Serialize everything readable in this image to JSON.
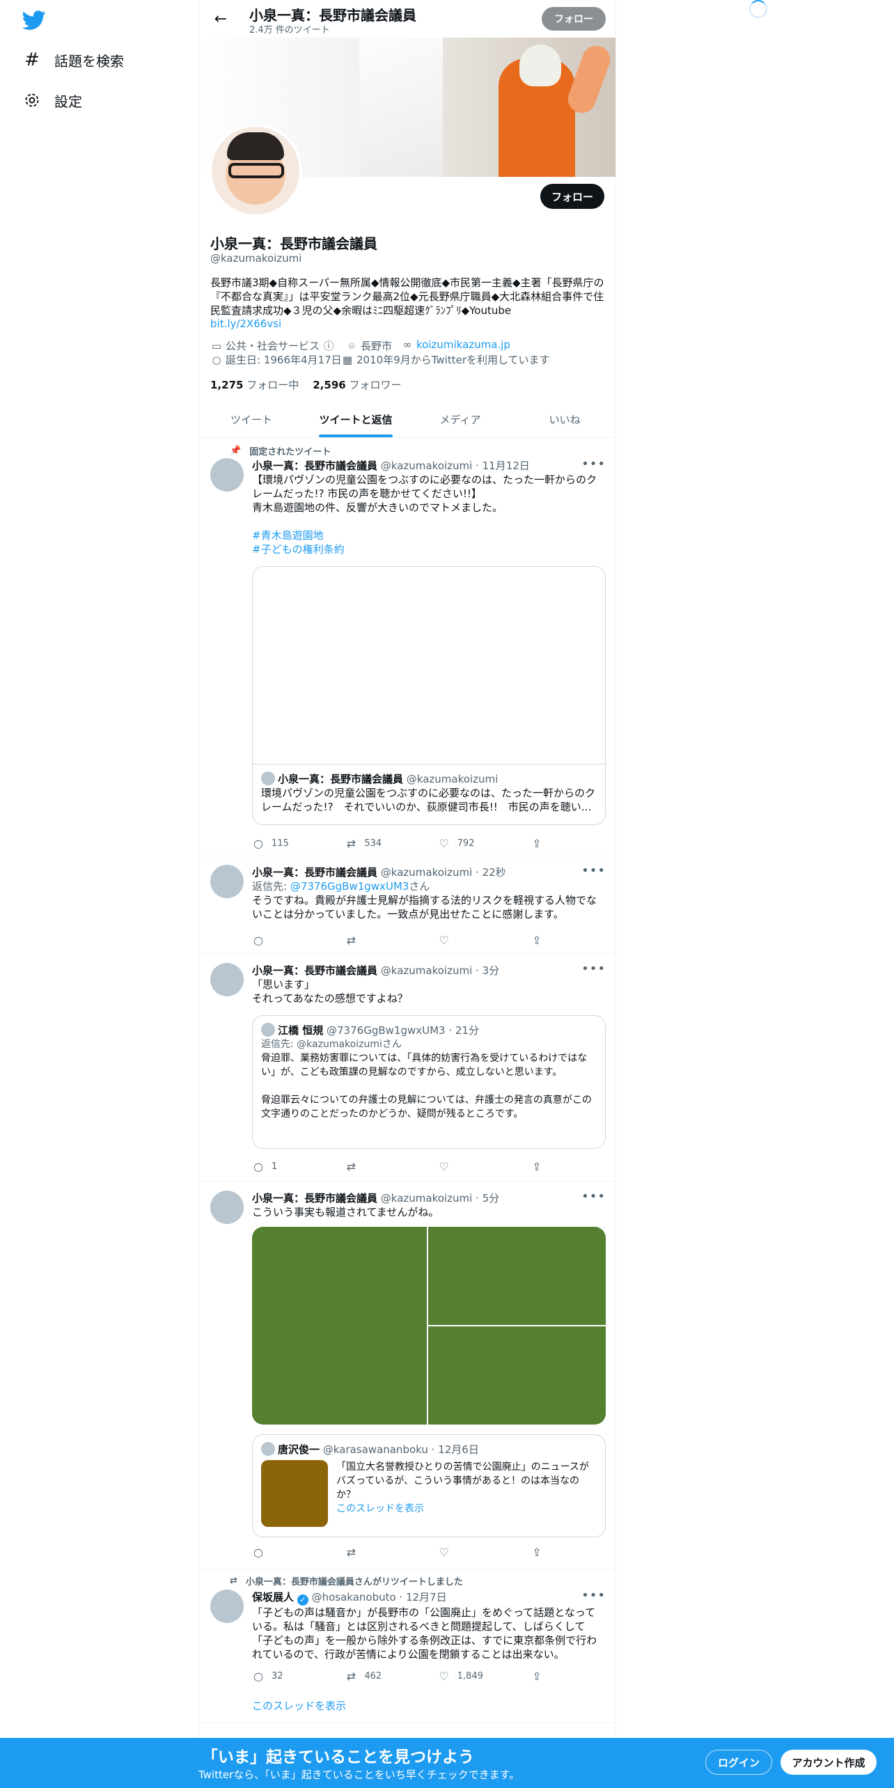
{
  "sidebar": {
    "items": [
      {
        "label": "話題を検索",
        "icon": "hashtag-icon"
      },
      {
        "label": "設定",
        "icon": "gear-icon"
      }
    ]
  },
  "header": {
    "title": "小泉一真：長野市議会議員",
    "tweet_count": "2.4万 件のツイート",
    "follow_label": "フォロー"
  },
  "profile": {
    "name": "小泉一真：長野市議会議員",
    "handle": "@kazumakoizumi",
    "bio": "長野市議3期◆自称スーパー無所属◆情報公開徹底◆市民第一主義◆主著「長野県庁の『不都合な真実』」は平安堂ランク最高2位◆元長野県庁職員◆大北森林組合事件で住民監査請求成功◆３児の父◆余暇はﾐﾆ四駆超速ｸﾞﾗﾝﾌﾟﾘ◆Youtube",
    "bio_link": "bit.ly/2X66vsi",
    "follow_label": "フォロー",
    "category": "公共・社会サービス",
    "location": "長野市",
    "website": "koizumikazuma.jp",
    "birthday": "誕生日: 1966年4月17日",
    "joined": "2010年9月からTwitterを利用しています",
    "following_count": "1,275",
    "following_label": "フォロー中",
    "followers_count": "2,596",
    "followers_label": "フォロワー"
  },
  "tabs": [
    {
      "label": "ツイート",
      "active": false
    },
    {
      "label": "ツイートと返信",
      "active": true
    },
    {
      "label": "メディア",
      "active": false
    },
    {
      "label": "いいね",
      "active": false
    }
  ],
  "tweets": [
    {
      "pinned_label": "固定されたツイート",
      "name": "小泉一真：長野市議会議員",
      "handle": "@kazumakoizumi",
      "time": "11月12日",
      "text": "【環境パヴゾンの児童公園をつぶすのに必要なのは、たった一軒からのクレームだった!? 市民の声を聴かせてください!!】\n青木島遊園地の件、反響が大きいのでマトメました。",
      "hashtags": [
        "#青木島遊園地",
        "#子どもの権利条約"
      ],
      "card_name": "小泉一真：長野市議会議員",
      "card_handle": "@kazumakoizumi",
      "card_text": "環境パヴゾンの児童公園をつぶすのに必要なのは、たった一軒からのクレームだった!?　それでいいのか、荻原健司市長!!　市民の声を聴い…",
      "replies": "115",
      "retweets": "534",
      "likes": "792"
    },
    {
      "name": "小泉一真：長野市議会議員",
      "handle": "@kazumakoizumi",
      "time": "22秒",
      "reply_to_prefix": "返信先: ",
      "reply_to": "@7376GgBw1gwxUM3",
      "reply_to_suffix": "さん",
      "text": "そうですね。貴殿が弁護士見解が指摘する法的リスクを軽視する人物でないことは分かっていました。一致点が見出せたことに感謝します。"
    },
    {
      "name": "小泉一真：長野市議会議員",
      "handle": "@kazumakoizumi",
      "time": "3分",
      "text": "「思います」\nそれってあなたの感想ですよね？",
      "quote_name": "江橋 恒規",
      "quote_handle": "@7376GgBw1gwxUM3",
      "quote_time": "21分",
      "quote_reply_to": "返信先: @kazumakoizumiさん",
      "quote_text": "脅迫罪、業務妨害罪については、「具体的妨害行為を受けているわけではない」が、こども政策課の見解なのですから、成立しないと思います。\n\n脅迫罪云々についての弁護士の見解については、弁護士の発言の真意がこの文字通りのことだったのかどうか、疑問が残るところです。",
      "replies": "1"
    },
    {
      "name": "小泉一真：長野市議会議員",
      "handle": "@kazumakoizumi",
      "time": "5分",
      "text": "こういう事実も報道されてませんがね。",
      "quote_name": "唐沢俊一",
      "quote_handle": "@karasawananboku",
      "quote_time": "12月6日",
      "quote_text": "「国立大名誉教授ひとりの苦情で公園廃止」のニュースがバズっているが、こういう事情があると！のは本当なのか？",
      "quote_thread": "このスレッドを表示",
      "media_color": "#548030",
      "thumb_color": "#8b6508"
    },
    {
      "retweet_label": "小泉一真：長野市議会議員さんがリツイートしました",
      "name": "保坂展人",
      "handle": "@hosakanobuto",
      "time": "12月7日",
      "text": "「子どもの声は騒音か」が長野市の「公園廃止」をめぐって話題となっている。私は「騒音」とは区別されるべきと問題提起して、しばらくして「子どもの声」を一般から除外する条例改正は、すでに東京都条例で行われているので、行政が苦情により公園を閉鎖することは出来ない。",
      "replies": "32",
      "retweets": "462",
      "likes": "1,849",
      "thread_link": "このスレッドを表示"
    }
  ],
  "bottom_bar": {
    "title": "「いま」起きていることを見つけよう",
    "subtitle": "Twitterなら、「いま」起きていることをいち早くチェックできます。",
    "login": "ログイン",
    "signup": "アカウント作成"
  },
  "colors": {
    "accent": "#1d9bf0",
    "text": "#0f1419",
    "muted": "#536471"
  }
}
